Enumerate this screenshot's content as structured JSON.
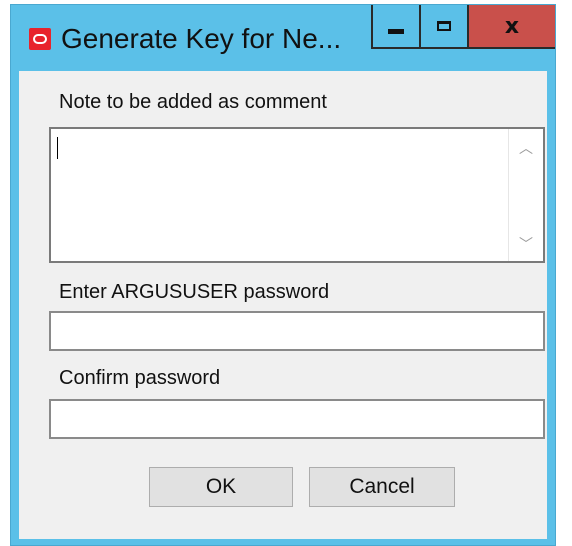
{
  "window": {
    "title": "Generate Key for Ne...",
    "controls": {
      "minimize_icon": "minimize-icon",
      "maximize_icon": "maximize-icon",
      "close_glyph": "x"
    }
  },
  "form": {
    "note_label": "Note to be added as comment",
    "note_value": "",
    "password_label": "Enter ARGUSUSER password",
    "password_value": "",
    "confirm_label": "Confirm password",
    "confirm_value": ""
  },
  "buttons": {
    "ok_label": "OK",
    "cancel_label": "Cancel"
  },
  "colors": {
    "titlebar": "#5bc0e8",
    "close_button": "#c9504b",
    "client_background": "#f0f0f0"
  }
}
